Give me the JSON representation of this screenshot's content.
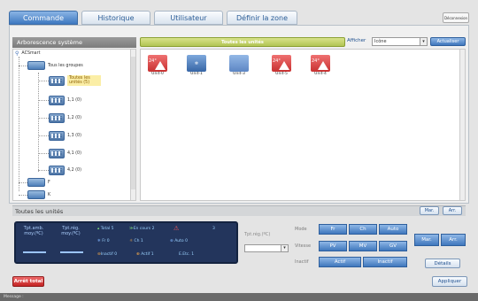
{
  "tabs": [
    {
      "label": "Commande"
    },
    {
      "label": "Historique"
    },
    {
      "label": "Utilisateur"
    },
    {
      "label": "Définir la zone"
    }
  ],
  "disconnect_label": "Déconnexion",
  "tree": {
    "title": "Arborescence système",
    "root": "ACSmart",
    "all_groups": "Tous les groupes",
    "all_units": "Toutes les unités (5)",
    "groups": [
      "1,1 (0)",
      "1,2 (0)",
      "1,3 (0)",
      "4,1 (0)",
      "4,2 (0)"
    ],
    "extra": [
      "F",
      "K"
    ]
  },
  "units_panel": {
    "title": "Toutes les unités",
    "afficher_label": "Afficher",
    "view_value": "Icône",
    "refresh_label": "Actualiser",
    "units": [
      {
        "label": "Unit-0",
        "state": "alarm",
        "code": "24°"
      },
      {
        "label": "Unit-1",
        "state": "normal"
      },
      {
        "label": "Unit-3",
        "state": "off"
      },
      {
        "label": "Unit-5",
        "state": "alarm",
        "code": "24°"
      },
      {
        "label": "Unit-4",
        "state": "alarm",
        "code": "24°"
      }
    ]
  },
  "control": {
    "title": "Toutes les unités",
    "mar": "Mar.",
    "arr": "Arr.",
    "tpt_amb": "Tpt.amb. moy.(ºC)",
    "tpt_reg": "Tpt.rég. moy.(ºC)",
    "dash": "——",
    "stats": {
      "total_label": "Total",
      "total": "5",
      "encours_label": "En cours",
      "encours": "2",
      "alarm": "3",
      "fr_label": "Fr",
      "fr": "0",
      "ch_label": "Ch",
      "ch": "1",
      "auto_label": "Auto",
      "auto": "0",
      "inactif_label": "Inactif",
      "inactif": "0",
      "actif_label": "Actif",
      "actif": "1",
      "etc_label": "E.Etc.",
      "etc": "1"
    },
    "tpt_reg_label": "Tpt.rég.(ºC)",
    "mode_label": "Mode",
    "vitesse_label": "Vitesse",
    "inactif_label": "Inactif",
    "mode_buttons": [
      "Fr",
      "Ch",
      "Auto"
    ],
    "speed_buttons": [
      "PV",
      "MV",
      "GV"
    ],
    "activity_buttons": [
      "Actif",
      "Inactif"
    ],
    "details_label": "Détails"
  },
  "bottom": {
    "arret_total": "Arrêt total",
    "appliquer": "Appliquer"
  },
  "status_text": "Message :"
}
